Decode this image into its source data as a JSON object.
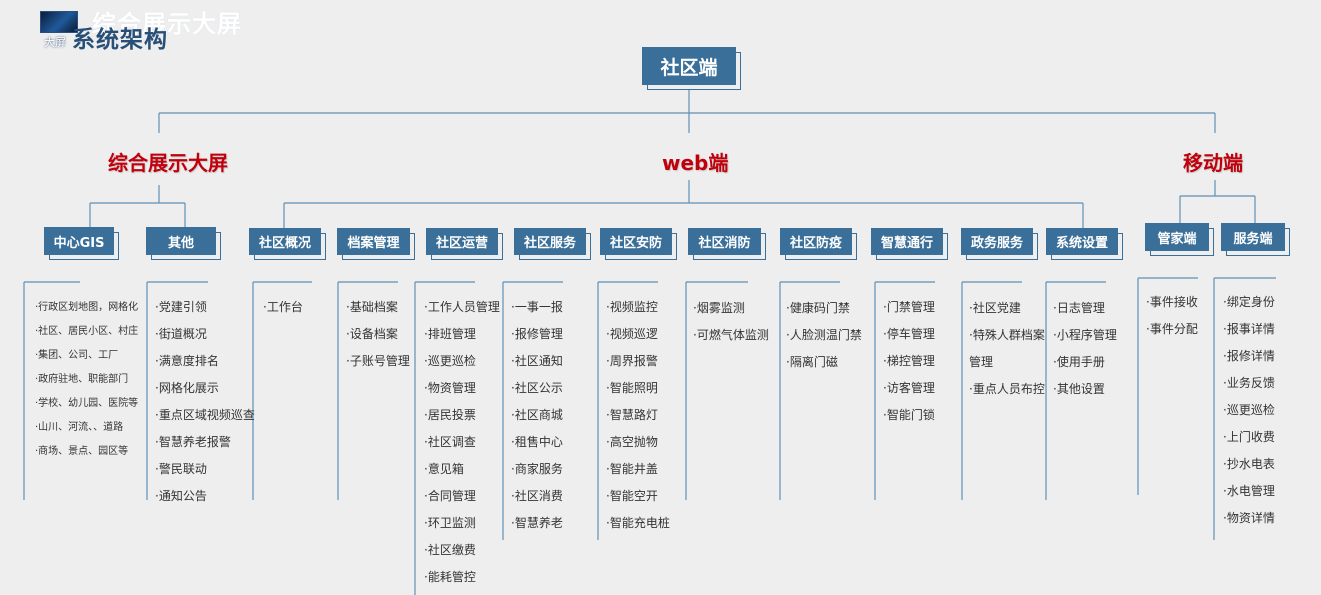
{
  "header": {
    "ghost_title": "综合展示大屏",
    "logo_label": "大屏",
    "title": "系统架构"
  },
  "root": "社区端",
  "categories": [
    {
      "label": "综合展示大屏",
      "modules": [
        {
          "label": "中心GIS",
          "items": [
            "·行政区划地图，网格化",
            "·社区、居民小区、村庄",
            "·集团、公司、工厂",
            "·政府驻地、职能部门",
            "·学校、幼儿园、医院等",
            "·山川、河流、、道路",
            "·商场、景点、园区等"
          ]
        },
        {
          "label": "其他",
          "items": [
            "·党建引领",
            "·街道概况",
            "·满意度排名",
            "·网格化展示",
            "·重点区域视频巡查",
            "·智慧养老报警",
            "·警民联动",
            "·通知公告"
          ]
        }
      ]
    },
    {
      "label": "web端",
      "modules": [
        {
          "label": "社区概况",
          "items": [
            "·工作台"
          ]
        },
        {
          "label": "档案管理",
          "items": [
            "·基础档案",
            "·设备档案",
            "·子账号管理"
          ]
        },
        {
          "label": "社区运营",
          "items": [
            "·工作人员管理",
            "·排班管理",
            "·巡更巡检",
            "·物资管理",
            "·居民投票",
            "·社区调查",
            "·意见箱",
            "·合同管理",
            "·环卫监测",
            "·社区缴费",
            "·能耗管控"
          ]
        },
        {
          "label": "社区服务",
          "items": [
            "·一事一报",
            "·报修管理",
            "·社区通知",
            "·社区公示",
            "·社区商城",
            "·租售中心",
            "·商家服务",
            "·社区消费",
            "·智慧养老"
          ]
        },
        {
          "label": "社区安防",
          "items": [
            "·视频监控",
            "·视频巡逻",
            "·周界报警",
            "·智能照明",
            "·智慧路灯",
            "·高空抛物",
            "·智能井盖",
            "·智能空开",
            "·智能充电桩"
          ]
        },
        {
          "label": "社区消防",
          "items": [
            "·烟雾监测",
            "·可燃气体监测"
          ]
        },
        {
          "label": "社区防疫",
          "items": [
            "·健康码门禁",
            "·人脸测温门禁",
            "·隔离门磁"
          ]
        },
        {
          "label": "智慧通行",
          "items": [
            "·门禁管理",
            "·停车管理",
            "·梯控管理",
            "·访客管理",
            "·智能门锁"
          ]
        },
        {
          "label": "政务服务",
          "items": [
            "·社区党建",
            "·特殊人群档案",
            "管理",
            "·重点人员布控"
          ]
        },
        {
          "label": "系统设置",
          "items": [
            "·日志管理",
            "·小程序管理",
            "·使用手册",
            "·其他设置"
          ]
        }
      ]
    },
    {
      "label": "移动端",
      "modules": [
        {
          "label": "管家端",
          "items": [
            "·事件接收",
            "·事件分配"
          ]
        },
        {
          "label": "服务端",
          "items": [
            "·绑定身份",
            "·报事详情",
            "·报修详情",
            "·业务反馈",
            "·巡更巡检",
            "·上门收费",
            "·抄水电表",
            "·水电管理",
            "·物资详情"
          ]
        }
      ]
    }
  ],
  "colors": {
    "box_fill": "#3a6f99",
    "connector": "#5e90b6",
    "category_text": "#c0000c",
    "title_text": "#284f78",
    "background": "#eeeeee"
  }
}
